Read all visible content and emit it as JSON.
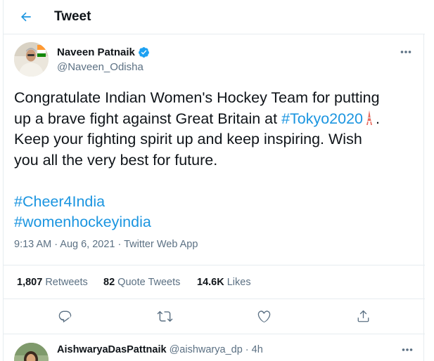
{
  "header": {
    "title": "Tweet"
  },
  "tweet": {
    "author_name": "Naveen Patnaik",
    "author_handle": "@Naveen_Odisha",
    "text": {
      "l1": "Congratulate Indian Women's Hockey Team for putting",
      "l2_pre": "up a brave fight against Great Britain at ",
      "l2_hashtag": "#Tokyo2020",
      "l2_post": ".",
      "l3": "Keep your fighting spirit up and keep inspiring. Wish",
      "l4": "you all the very best for future.",
      "hashtag1": "#Cheer4India",
      "hashtag2": "#womenhockeyindia"
    },
    "timestamp": "9:13 AM · Aug 6, 2021 · ",
    "source": "Twitter Web App"
  },
  "stats": {
    "retweets_count": "1,807",
    "retweets_label": "Retweets",
    "quotes_count": "82",
    "quotes_label": "Quote Tweets",
    "likes_count": "14.6K",
    "likes_label": "Likes"
  },
  "reply": {
    "name": "AishwaryaDasPattnaik",
    "handle": "@aishwarya_dp",
    "dot": " · ",
    "time": "4h"
  },
  "colors": {
    "accent": "#1b95e0",
    "text": "#0f1419",
    "secondary": "#5b7083",
    "border": "#e6ecf0"
  },
  "icons": {
    "back": "arrow-left-icon",
    "verified": "verified-badge-icon",
    "more": "ellipsis-icon",
    "reply": "comment-icon",
    "retweet": "retweet-icon",
    "like": "heart-icon",
    "share": "share-icon",
    "emoji": "tokyo-tower-emoji"
  }
}
